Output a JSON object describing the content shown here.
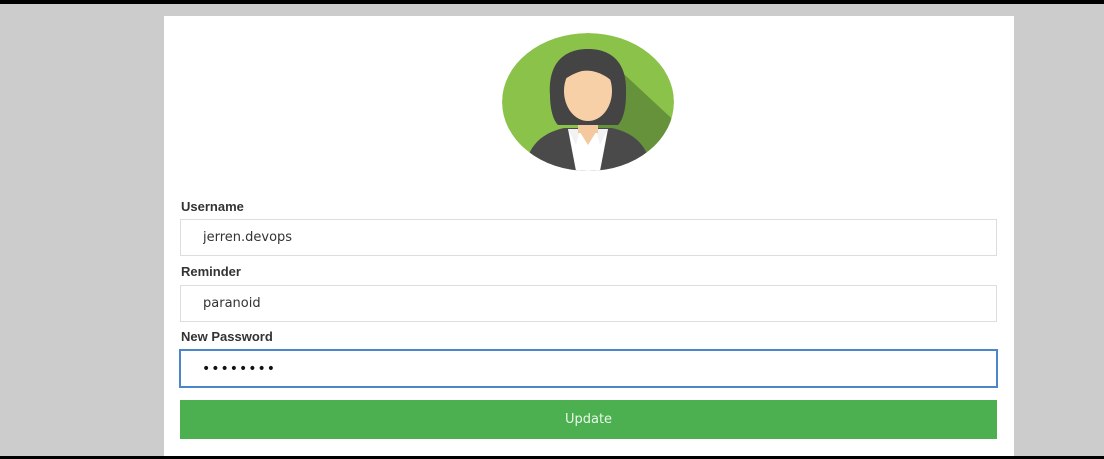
{
  "form": {
    "username": {
      "label": "Username",
      "value": "jerren.devops"
    },
    "reminder": {
      "label": "Reminder",
      "value": "paranoid"
    },
    "new_password": {
      "label": "New Password",
      "value": "passw0rd",
      "state": "focused",
      "input_type": "password"
    },
    "update_button": {
      "label": "Update"
    }
  },
  "avatar": {
    "icon": "user-avatar-icon",
    "background_color": "#8bc34a"
  },
  "colors": {
    "page_background": "#cccccc",
    "card_background": "#ffffff",
    "accent": "#4caf50",
    "focus_border": "#4a86c8"
  }
}
